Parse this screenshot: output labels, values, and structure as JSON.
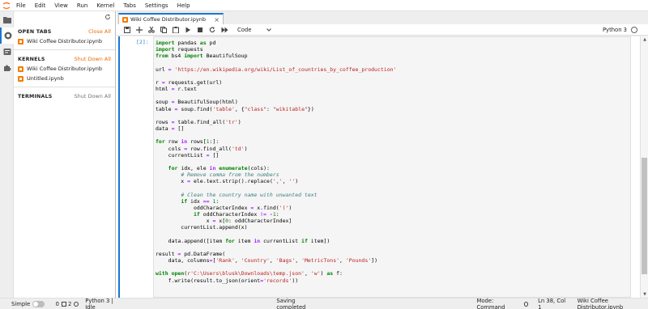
{
  "menubar": {
    "items": [
      "File",
      "Edit",
      "View",
      "Run",
      "Kernel",
      "Tabs",
      "Settings",
      "Help"
    ]
  },
  "sidebar": {
    "open_tabs": {
      "title": "OPEN TABS",
      "action": "Close All",
      "items": [
        "Wiki Coffee Distributor.ipynb"
      ]
    },
    "kernels": {
      "title": "KERNELS",
      "action": "Shut Down All",
      "items": [
        "Wiki Coffee Distributor.ipynb",
        "Untitled.ipynb"
      ]
    },
    "terminals": {
      "title": "TERMINALS",
      "action": "Shut Down All"
    }
  },
  "tab": {
    "label": "Wiki Coffee Distributor.ipynb",
    "close": "×"
  },
  "toolbar": {
    "cell_type": "Code",
    "kernel_name": "Python 3"
  },
  "cell": {
    "prompt": "[2]:"
  },
  "status": {
    "mode_label": "Simple",
    "count_a": "0",
    "count_b": "2",
    "kernel_state": "Python 3 | Idle",
    "save_state": "Saving completed",
    "mode": "Mode: Command",
    "position": "Ln 38, Col 1",
    "file": "Wiki Coffee Distributor.ipynb"
  },
  "colors": {
    "accent": "#1976d2",
    "notebook_icon": "#f57c00",
    "sidebar_action": "#ef6c00"
  },
  "icons": [
    "jupyter-logo",
    "folder-icon",
    "running-icon",
    "palette-icon",
    "extension-icon",
    "refresh-icon",
    "save-icon",
    "add-icon",
    "cut-icon",
    "copy-icon",
    "paste-icon",
    "run-icon",
    "stop-icon",
    "restart-icon",
    "fast-forward-icon",
    "chevron-down-icon"
  ]
}
